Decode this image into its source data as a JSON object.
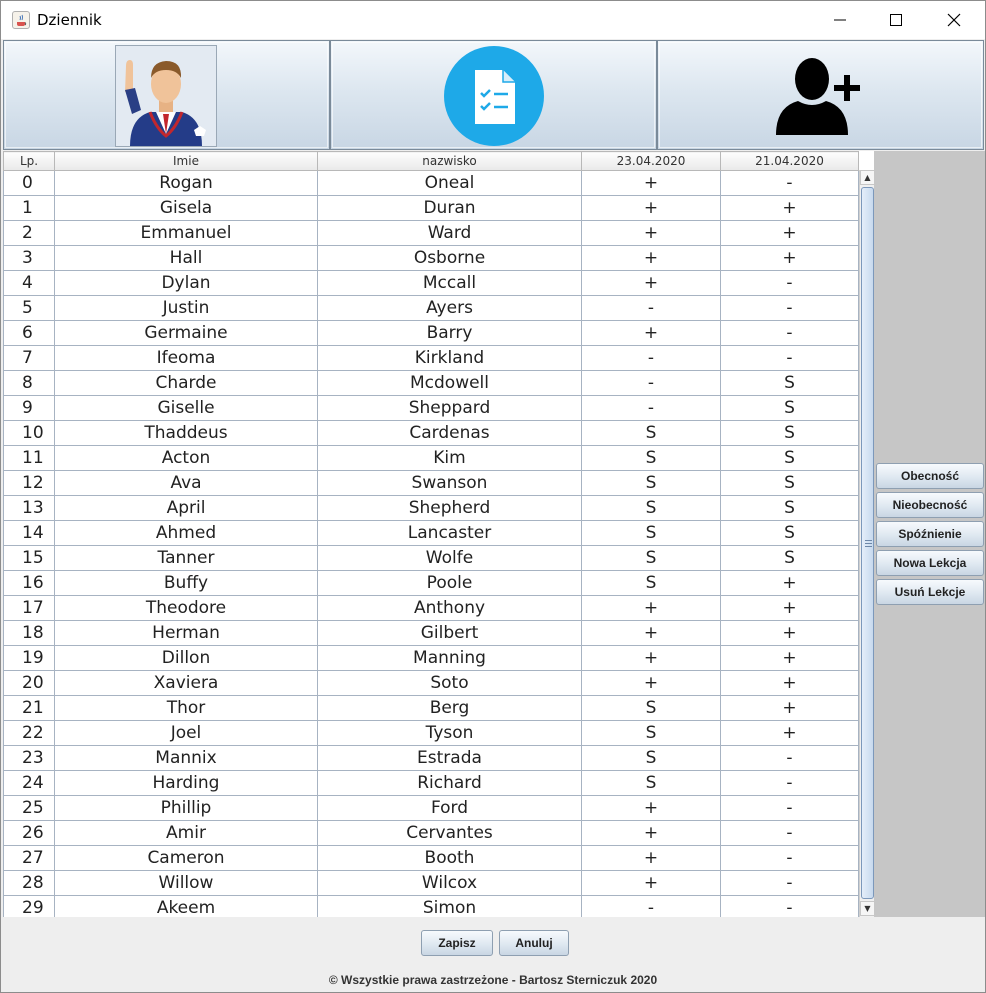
{
  "window": {
    "title": "Dziennik"
  },
  "toolbar": {
    "icons": [
      "student-avatar-icon",
      "attendance-checklist-icon",
      "add-user-icon"
    ],
    "colors": {
      "checklist_circle": "#1ea9e8",
      "add_user": "#000000"
    }
  },
  "table": {
    "columns": [
      "Lp.",
      "Imie",
      "nazwisko",
      "23.04.2020",
      "21.04.2020"
    ],
    "rows": [
      [
        "0",
        "Rogan",
        "Oneal",
        "+",
        "-"
      ],
      [
        "1",
        "Gisela",
        "Duran",
        "+",
        "+"
      ],
      [
        "2",
        "Emmanuel",
        "Ward",
        "+",
        "+"
      ],
      [
        "3",
        "Hall",
        "Osborne",
        "+",
        "+"
      ],
      [
        "4",
        "Dylan",
        "Mccall",
        "+",
        "-"
      ],
      [
        "5",
        "Justin",
        "Ayers",
        "-",
        "-"
      ],
      [
        "6",
        "Germaine",
        "Barry",
        "+",
        "-"
      ],
      [
        "7",
        "Ifeoma",
        "Kirkland",
        "-",
        "-"
      ],
      [
        "8",
        "Charde",
        "Mcdowell",
        "-",
        "S"
      ],
      [
        "9",
        "Giselle",
        "Sheppard",
        "-",
        "S"
      ],
      [
        "10",
        "Thaddeus",
        "Cardenas",
        "S",
        "S"
      ],
      [
        "11",
        "Acton",
        "Kim",
        "S",
        "S"
      ],
      [
        "12",
        "Ava",
        "Swanson",
        "S",
        "S"
      ],
      [
        "13",
        "April",
        "Shepherd",
        "S",
        "S"
      ],
      [
        "14",
        "Ahmed",
        "Lancaster",
        "S",
        "S"
      ],
      [
        "15",
        "Tanner",
        "Wolfe",
        "S",
        "S"
      ],
      [
        "16",
        "Buffy",
        "Poole",
        "S",
        "+"
      ],
      [
        "17",
        "Theodore",
        "Anthony",
        "+",
        "+"
      ],
      [
        "18",
        "Herman",
        "Gilbert",
        "+",
        "+"
      ],
      [
        "19",
        "Dillon",
        "Manning",
        "+",
        "+"
      ],
      [
        "20",
        "Xaviera",
        "Soto",
        "+",
        "+"
      ],
      [
        "21",
        "Thor",
        "Berg",
        "S",
        "+"
      ],
      [
        "22",
        "Joel",
        "Tyson",
        "S",
        "+"
      ],
      [
        "23",
        "Mannix",
        "Estrada",
        "S",
        "-"
      ],
      [
        "24",
        "Harding",
        "Richard",
        "S",
        "-"
      ],
      [
        "25",
        "Phillip",
        "Ford",
        "+",
        "-"
      ],
      [
        "26",
        "Amir",
        "Cervantes",
        "+",
        "-"
      ],
      [
        "27",
        "Cameron",
        "Booth",
        "+",
        "-"
      ],
      [
        "28",
        "Willow",
        "Wilcox",
        "+",
        "-"
      ],
      [
        "29",
        "Akeem",
        "Simon",
        "-",
        "-"
      ]
    ]
  },
  "side_buttons": [
    "Obecność",
    "Nieobecność",
    "Spóźnienie",
    "Nowa Lekcja",
    "Usuń Lekcje"
  ],
  "bottom_buttons": {
    "save": "Zapisz",
    "cancel": "Anuluj"
  },
  "footer": "© Wszystkie prawa zastrzeżone - Bartosz Sterniczuk 2020"
}
